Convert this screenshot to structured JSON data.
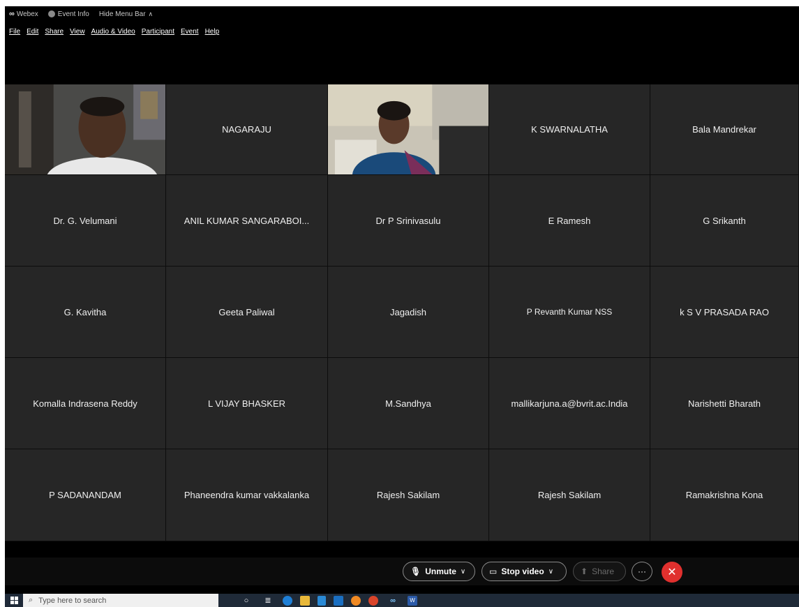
{
  "titlebar": {
    "app_name": "Webex",
    "event_info": "Event Info",
    "hide_menu": "Hide Menu Bar"
  },
  "menu": [
    "File",
    "Edit",
    "Share",
    "View",
    "Audio & Video",
    "Participant",
    "Event",
    "Help"
  ],
  "participants": [
    {
      "name": "",
      "video": true
    },
    {
      "name": "NAGARAJU",
      "video": false
    },
    {
      "name": "",
      "video": true
    },
    {
      "name": "K SWARNALATHA",
      "video": false
    },
    {
      "name": "Bala Mandrekar",
      "video": false
    },
    {
      "name": "Dr. G. Velumani",
      "video": false
    },
    {
      "name": "ANIL KUMAR SANGARABOI...",
      "video": false
    },
    {
      "name": "Dr P Srinivasulu",
      "video": false
    },
    {
      "name": "E Ramesh",
      "video": false
    },
    {
      "name": "G Srikanth",
      "video": false
    },
    {
      "name": "G.  Kavitha",
      "video": false
    },
    {
      "name": "Geeta Paliwal",
      "video": false
    },
    {
      "name": "Jagadish",
      "video": false
    },
    {
      "name": "P Revanth Kumar NSS",
      "video": false
    },
    {
      "name": "k S V PRASADA RAO",
      "video": false
    },
    {
      "name": "Komalla Indrasena Reddy",
      "video": false
    },
    {
      "name": "L VIJAY BHASKER",
      "video": false
    },
    {
      "name": "M.Sandhya",
      "video": false
    },
    {
      "name": "mallikarjuna.a@bvrit.ac.India",
      "video": false
    },
    {
      "name": "Narishetti Bharath",
      "video": false
    },
    {
      "name": "P SADANANDAM",
      "video": false
    },
    {
      "name": "Phaneendra kumar vakkalanka",
      "video": false
    },
    {
      "name": "Rajesh Sakilam",
      "video": false
    },
    {
      "name": "Rajesh Sakilam",
      "video": false
    },
    {
      "name": "Ramakrishna Kona",
      "video": false
    }
  ],
  "controls": {
    "unmute": "Unmute",
    "stop_video": "Stop video",
    "share": "Share",
    "more": "···",
    "end": "✕"
  },
  "taskbar": {
    "search_placeholder": "Type here to search",
    "apps": [
      "task-view-icon",
      "edge-icon",
      "file-explorer-icon",
      "store-icon",
      "mail-icon",
      "firefox-icon",
      "chrome-icon",
      "webex-icon",
      "word-icon"
    ]
  },
  "colors": {
    "tile_bg": "#262626",
    "end_button": "#e0302e",
    "taskbar": "#1f2a38"
  }
}
